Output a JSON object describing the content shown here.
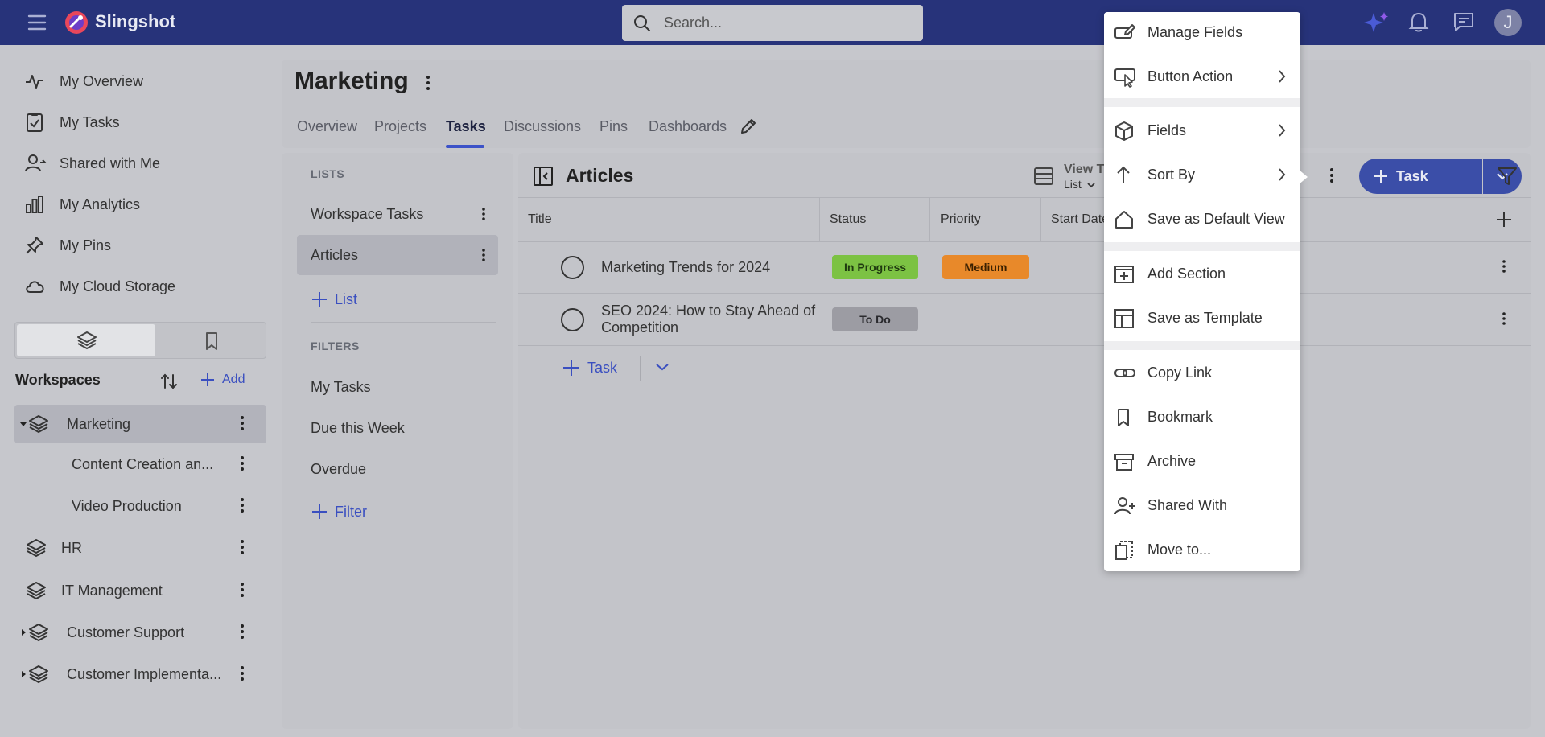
{
  "app": {
    "brand": "Slingshot",
    "avatar_initial": "J"
  },
  "search": {
    "placeholder": "Search..."
  },
  "nav": {
    "items": [
      {
        "label": "My Overview",
        "icon": "pulse-icon"
      },
      {
        "label": "My Tasks",
        "icon": "task-clipboard-icon"
      },
      {
        "label": "Shared with Me",
        "icon": "shared-user-icon"
      },
      {
        "label": "My Analytics",
        "icon": "bar-chart-icon"
      },
      {
        "label": "My Pins",
        "icon": "pin-icon"
      },
      {
        "label": "My Cloud Storage",
        "icon": "cloud-icon"
      }
    ]
  },
  "workspaces": {
    "header": "Workspaces",
    "add_label": "Add",
    "items": [
      {
        "label": "Marketing",
        "level": 0
      },
      {
        "label": "Content Creation an...",
        "level": 1
      },
      {
        "label": "Video Production",
        "level": 1
      },
      {
        "label": "HR",
        "level": 0
      },
      {
        "label": "IT Management",
        "level": 0
      },
      {
        "label": "Customer Support",
        "level": 0
      },
      {
        "label": "Customer Implementa...",
        "level": 0
      }
    ]
  },
  "page": {
    "title": "Marketing",
    "tabs": [
      "Overview",
      "Projects",
      "Tasks",
      "Discussions",
      "Pins",
      "Dashboards"
    ],
    "active_tab": "Tasks"
  },
  "lists": {
    "lists_label": "LISTS",
    "items": [
      "Workspace Tasks",
      "Articles"
    ],
    "add_list_label": "List",
    "filters_label": "FILTERS",
    "filters": [
      "My Tasks",
      "Due this Week",
      "Overdue"
    ],
    "add_filter_label": "Filter"
  },
  "table": {
    "title": "Articles",
    "view_type_label": "View T",
    "view_type_value": "List",
    "task_button": "Task",
    "columns": [
      "Title",
      "Status",
      "Priority",
      "Start Date"
    ],
    "rows": [
      {
        "title": "Marketing Trends for 2024",
        "status": "In Progress",
        "priority": "Medium"
      },
      {
        "title_line1": "SEO 2024: How to Stay Ahead of",
        "title_line2": "Competition",
        "status": "To Do",
        "priority": ""
      }
    ],
    "add_task_label": "Task"
  },
  "menu": {
    "items": [
      {
        "label": "Manage Fields",
        "icon": "edit-fields-icon"
      },
      {
        "label": "Button Action",
        "icon": "button-click-icon"
      },
      {
        "label": "Fields",
        "icon": "cube-icon"
      },
      {
        "label": "Sort By",
        "icon": "arrow-up-icon"
      },
      {
        "label": "Save as Default View",
        "icon": "home-icon"
      },
      {
        "label": "Add Section",
        "icon": "add-section-icon"
      },
      {
        "label": "Save as Template",
        "icon": "template-icon"
      },
      {
        "label": "Copy Link",
        "icon": "link-icon"
      },
      {
        "label": "Bookmark",
        "icon": "bookmark-icon"
      },
      {
        "label": "Archive",
        "icon": "archive-icon"
      },
      {
        "label": "Shared With",
        "icon": "user-add-icon"
      },
      {
        "label": "Move to...",
        "icon": "move-icon"
      }
    ]
  },
  "colors": {
    "topbar": "#27337a",
    "accent": "#3b4ea8",
    "status_in_progress": "#7cc243",
    "status_to_do": "#9c9ca3",
    "priority_medium": "#e8892a"
  }
}
